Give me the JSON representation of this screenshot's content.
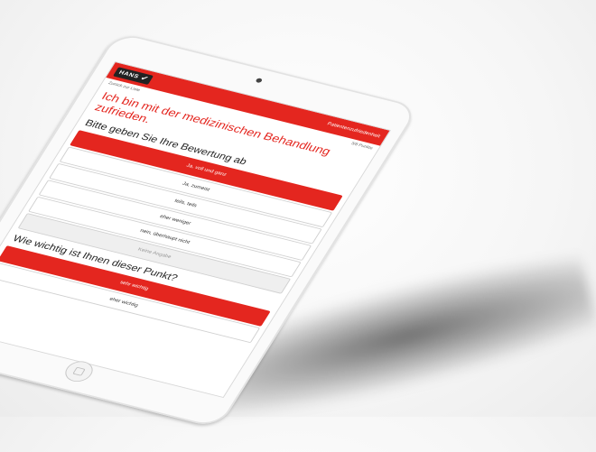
{
  "app": {
    "logo_text": "HANS",
    "header_link": "Patientenzufriedenheit",
    "back_label": "Zurück zur Liste",
    "progress_label": "3/8 Punkte"
  },
  "question": {
    "statement": "Ich bin mit der medizinischen Behandlung zufrieden.",
    "rating_prompt": "Bitte geben Sie Ihre Bewertung ab",
    "rating_options": [
      {
        "label": "Ja, voll und ganz",
        "selected": true
      },
      {
        "label": "Ja, zumeist",
        "selected": false
      },
      {
        "label": "teils, teils",
        "selected": false
      },
      {
        "label": "eher weniger",
        "selected": false
      },
      {
        "label": "nein, überhaupt nicht",
        "selected": false
      },
      {
        "label": "Keine Angabe",
        "selected": false
      }
    ],
    "importance_prompt": "Wie wichtig ist Ihnen dieser Punkt?",
    "importance_options": [
      {
        "label": "sehr wichtig",
        "selected": true
      },
      {
        "label": "eher wichtig",
        "selected": false
      }
    ]
  },
  "colors": {
    "accent": "#e4261f",
    "device": "#fafafa"
  }
}
